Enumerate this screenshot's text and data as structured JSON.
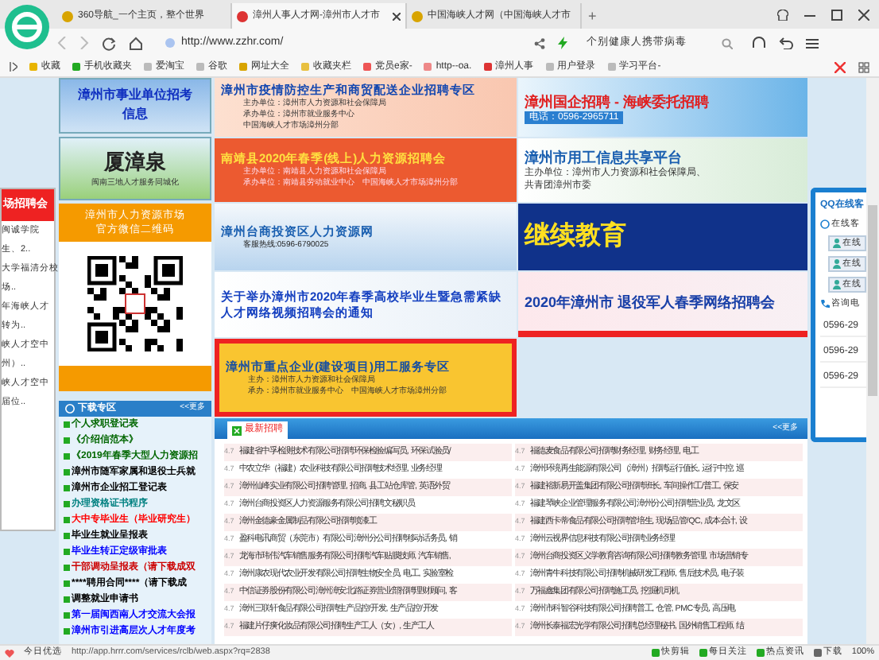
{
  "browser": {
    "tabs": [
      {
        "label": "360导航_一个主页，整个世界",
        "selected": false
      },
      {
        "label": "漳州人事人才网-漳州市人才市",
        "selected": true
      },
      {
        "label": "中国海峡人才网（中国海峡人才市",
        "selected": false
      }
    ],
    "new_tab_button": "+",
    "address": "http://www.zzhr.com/",
    "search": "个别健康人携带病毒",
    "bookmarks": [
      "收藏",
      "手机收藏夹",
      "爱淘宝",
      "谷歌",
      "网址大全",
      "收藏夹栏",
      "党员e家-",
      "http--oa.",
      "漳州人事",
      "用户登录",
      "学习平台-"
    ]
  },
  "left_partial": {
    "heading": "场招聘会",
    "items": [
      "闽诚学院",
      "生、2..",
      "大学福清分校",
      "场..",
      "年海峡人才",
      "转为..",
      "峡人才空中",
      "州）..",
      "峡人才空中",
      "届位.."
    ]
  },
  "side": {
    "banner_1": "漳州市事业单位招考信息",
    "banner_2": {
      "title": "厦漳泉",
      "subtitle": "闽南三地人才服务同城化"
    },
    "qr_title": [
      "漳州市人力资源市场",
      "官方微信二维码"
    ]
  },
  "center_banners": [
    {
      "title": "漳州市疫情防控生产和商贸配送企业招聘专区",
      "lines": [
        "主办单位：漳州市人力资源和社会保障局",
        "承办单位：漳州市就业服务中心",
        "中国海峡人才市场漳州分部"
      ]
    },
    {
      "title": "南靖县2020年春季(线上)人力资源招聘会",
      "lines": [
        "主办单位：南靖县人力资源和社会保障局",
        "承办单位：南靖县劳动就业中心　中国海峡人才市场漳州分部"
      ]
    },
    {
      "title": "漳州台商投资区人力资源网",
      "lines": [
        "客服热线:0596-6790025"
      ]
    },
    {
      "title": "关于举办漳州市2020年春季高校毕业生暨急需紧缺人才网络视频招聘会的通知"
    },
    {
      "title": "漳州市重点企业(建设项目)用工服务专区",
      "lines": [
        "主办：漳州市人力资源和社会保障局",
        "承办：漳州市就业服务中心　中国海峡人才市场漳州分部"
      ]
    }
  ],
  "right_banners": [
    {
      "title": "漳州国企招聘 - 海峡委托招聘",
      "lines": [
        "电话：0596-2965711"
      ]
    },
    {
      "title": "漳州市用工信息共享平台",
      "lines": [
        "主办单位：漳州市人力资源和社会保障局、",
        "共青团漳州市委"
      ]
    },
    {
      "title": "继续教育"
    },
    {
      "title": "2020年漳州市 退役军人春季网络招聘会"
    }
  ],
  "qq_panel": {
    "title": "QQ在线客",
    "online_label": "在线客",
    "buttons": [
      "在线",
      "在线",
      "在线"
    ],
    "phone_label": "咨询电",
    "phones": [
      "0596-29",
      "0596-29",
      "0596-29"
    ]
  },
  "downloads": {
    "title": "下载专区",
    "more": "<<更多",
    "items": [
      {
        "text": "个人求职登记表",
        "color": "#006600"
      },
      {
        "text": "《介绍信范本》",
        "color": "#006600"
      },
      {
        "text": "《2019年春季大型人力资源招",
        "color": "#006600"
      },
      {
        "text": "漳州市随军家属和退役士兵就",
        "color": "#000000"
      },
      {
        "text": "漳州市企业招工登记表",
        "color": "#000000"
      },
      {
        "text": "办理资格证书程序",
        "color": "#008080"
      },
      {
        "text": "大中专毕业生（毕业研究生）",
        "color": "#ff0000"
      },
      {
        "text": "毕业生就业呈报表",
        "color": "#000000"
      },
      {
        "text": "毕业生转正定级审批表",
        "color": "#0000ff"
      },
      {
        "text": "干部调动呈报表（请下载成双",
        "color": "#cc0000"
      },
      {
        "text": "****聘用合同****（请下载成",
        "color": "#000000"
      },
      {
        "text": "调整就业申请书",
        "color": "#000000"
      },
      {
        "text": "第一届闽西南人才交流大会报",
        "color": "#0000ff"
      },
      {
        "text": "漳州市引进高层次人才年度考",
        "color": "#0000ff"
      }
    ]
  },
  "news": {
    "tab": "最新招聘",
    "more": "<<更多",
    "left": [
      {
        "score": "4.7",
        "text": "福建省中孚检测技术有限公司招聘环保检验编写员, 环保试验员/"
      },
      {
        "score": "4.7",
        "text": "中农立华（福建）农业科技有限公司招聘技术经理, 业务经理"
      },
      {
        "score": "4.7",
        "text": "漳州仙峰实业有限公司招聘管理, 招商, 县工站仓库管, 英语外贸"
      },
      {
        "score": "4.7",
        "text": "漳州台商投资区人力资源服务有限公司招聘文秘职员"
      },
      {
        "score": "4.7",
        "text": "漳州金德豪金属制品有限公司招聘喷漆工"
      },
      {
        "score": "4.7",
        "text": "盈科电讯商贸（东莞市）有限公司漳州分公司招聘移动话务员, 销"
      },
      {
        "score": "4.7",
        "text": "龙海市玮伟汽车销售服务有限公司招聘汽车贴膜技师, 汽车销售,"
      },
      {
        "score": "4.7",
        "text": "漳州康农现代农业开发有限公司招聘生物安全员, 电工, 实验室检"
      },
      {
        "score": "4.7",
        "text": "中信证券股份有限公司漳州漳安北路证券营业部招聘理财顾问, 客"
      },
      {
        "score": "4.7",
        "text": "漳州三联轩食品有限公司招聘生产品控/开发, 生产品控/开发"
      },
      {
        "score": "4.7",
        "text": "福建片仔癀化妆品有限公司招聘生产工人（女）, 生产工人"
      }
    ],
    "right": [
      {
        "score": "4.7",
        "text": "福德麦食品有限公司招聘财务经理, 财务经理, 电工"
      },
      {
        "score": "4.7",
        "text": "漳州环境再生能源有限公司（漳州）招聘运行值长, 运行中控, 巡"
      },
      {
        "score": "4.7",
        "text": "福建裕新易开盖集团有限公司招聘班长, 车间操作工/普工, 保安"
      },
      {
        "score": "4.7",
        "text": "福建琴峡企业管理服务有限公司漳州分公司招聘营业员, 龙文区"
      },
      {
        "score": "4.7",
        "text": "福建西卡蒂食品有限公司招聘管培生, 现场品管/QC, 成本会计, 设"
      },
      {
        "score": "4.7",
        "text": "漳州云视界信息科技有限公司招聘业务经理"
      },
      {
        "score": "4.7",
        "text": "漳州台商投资区义学教育咨询有限公司招聘教务管理, 市场营销专"
      },
      {
        "score": "4.7",
        "text": "漳州青牛科技有限公司招聘机械研发工程师, 售后技术员, 电子装"
      },
      {
        "score": "4.7",
        "text": "万福鑫集团有限公司招聘施工员, 挖掘机司机"
      },
      {
        "score": "4.7",
        "text": "漳州市科智谷科技有限公司招聘普工, 仓管, PMC专员, 高压电"
      },
      {
        "score": "4.7",
        "text": "漳州长泰福宏光学有限公司招聘总经理秘书, 国外销售工程师, 结"
      }
    ]
  },
  "status_bar": {
    "left_label": "今日优选",
    "url": "http://app.hrrr.com/services/rclb/web.aspx?rq=2838",
    "items": [
      "快剪辑",
      "每日关注",
      "热点资讯",
      "下载"
    ],
    "zoom": "100%"
  }
}
